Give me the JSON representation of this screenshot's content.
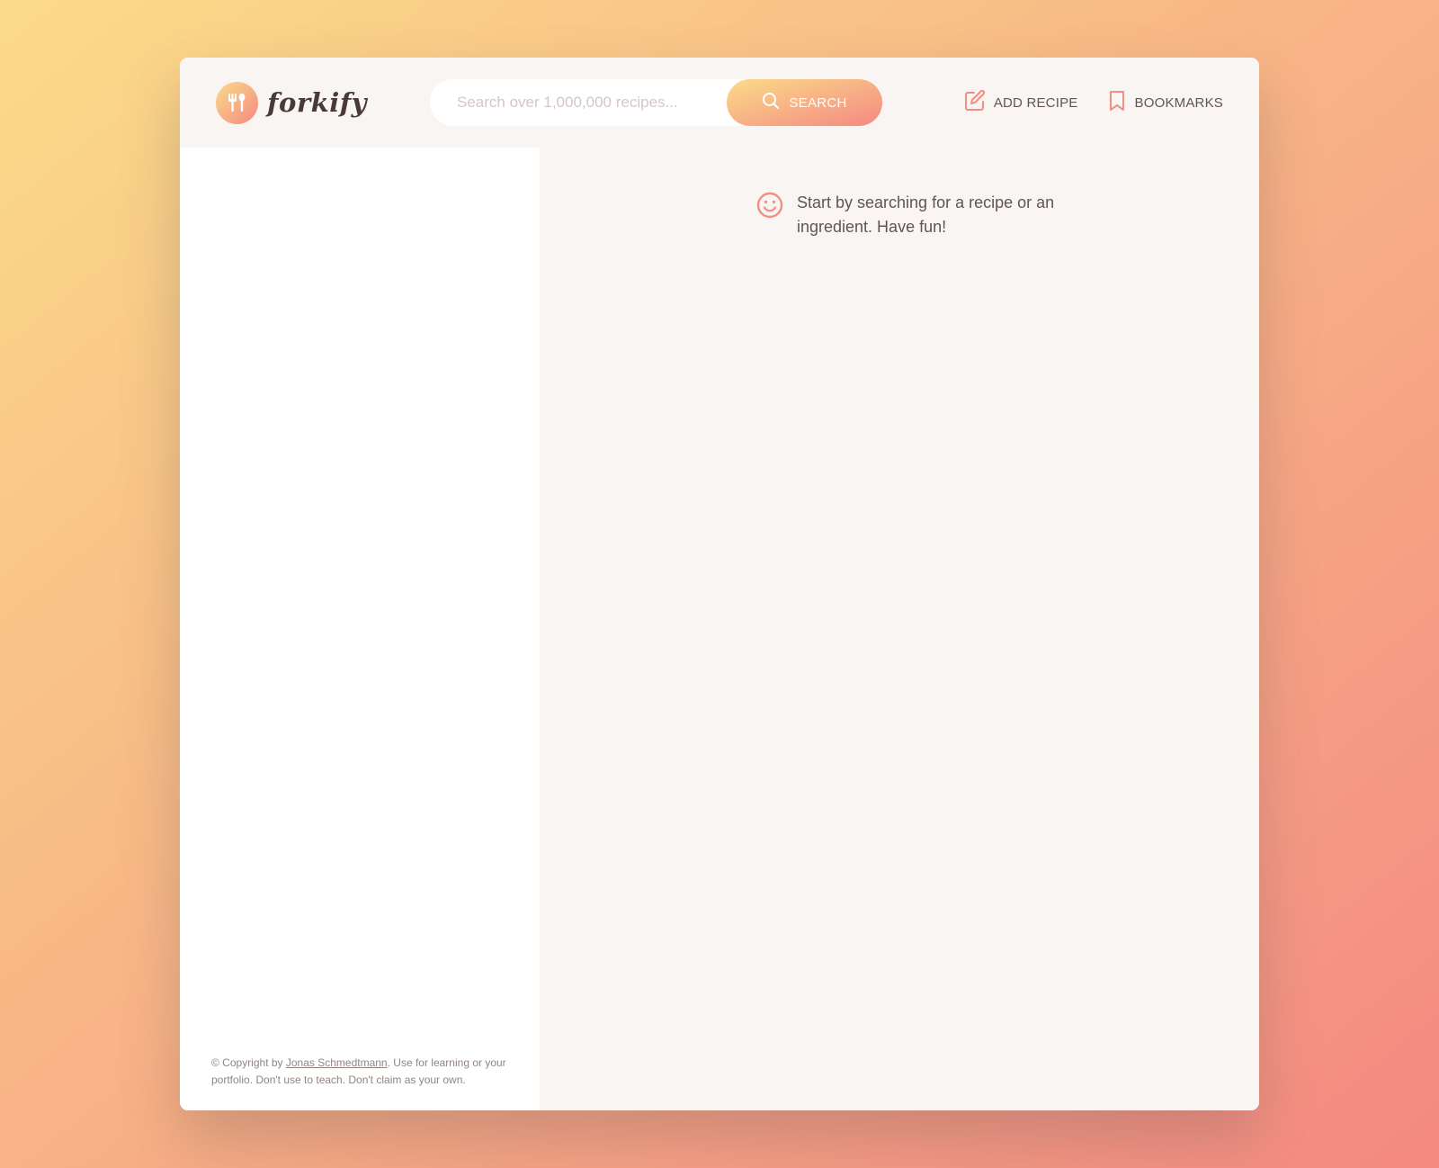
{
  "brand": {
    "logo_text": "forkify"
  },
  "search": {
    "placeholder": "Search over 1,000,000 recipes...",
    "value": "",
    "button_label": "SEARCH"
  },
  "nav": {
    "add_recipe_label": "ADD RECIPE",
    "bookmarks_label": "BOOKMARKS"
  },
  "message": {
    "text": "Start by searching for a recipe or an ingredient. Have fun!"
  },
  "footer": {
    "prefix": "© Copyright by ",
    "author_link": "Jonas Schmedtmann",
    "suffix": ". Use for learning or your portfolio. Don't use to teach. Don't claim as your own."
  },
  "colors": {
    "gradient_start": "#fbdb89",
    "gradient_end": "#f48982",
    "text": "#615551",
    "light_bg": "#f9f5f3"
  },
  "icons": {
    "logo": "fork-spoon-icon",
    "search": "search-icon",
    "add_recipe": "edit-icon",
    "bookmarks": "bookmark-icon",
    "message": "smile-icon"
  }
}
